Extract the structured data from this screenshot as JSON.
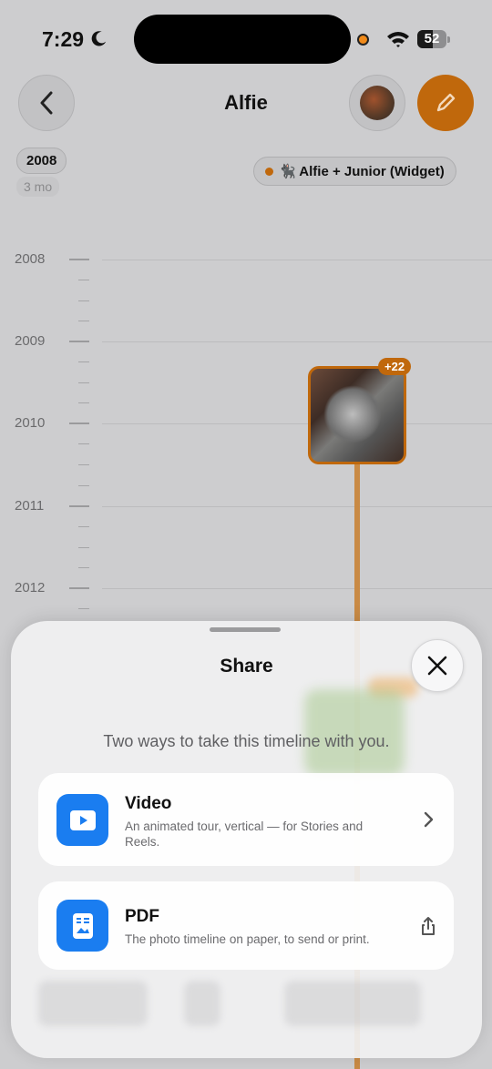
{
  "status_bar": {
    "time": "7:29",
    "battery": "52",
    "battery_level": 0.52
  },
  "nav": {
    "title": "Alfie"
  },
  "timeline": {
    "current_year": "2008",
    "duration": "3 mo",
    "filter_label": "🐈‍⬛ Alfie + Junior (Widget)",
    "years": [
      "2008",
      "2009",
      "2010",
      "2011",
      "2012"
    ],
    "photo_count_badge": "+22"
  },
  "share_sheet": {
    "title": "Share",
    "subtitle": "Two ways to take this timeline with you.",
    "options": [
      {
        "title": "Video",
        "description": "An animated tour, vertical — for Stories and Reels.",
        "icon": "play-icon",
        "trailing": "chevron-right-icon"
      },
      {
        "title": "PDF",
        "description": "The photo timeline on paper, to send or print.",
        "icon": "document-icon",
        "trailing": "share-icon"
      }
    ]
  },
  "colors": {
    "accent": "#c0680c",
    "icon_blue": "#1a7df0"
  }
}
